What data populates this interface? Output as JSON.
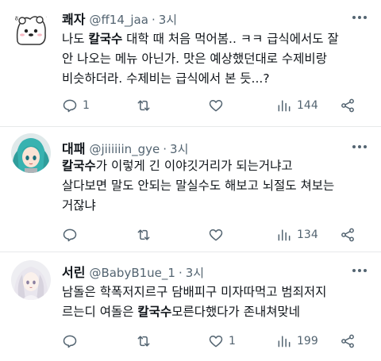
{
  "tweets": [
    {
      "name": "쾌자",
      "handle": "@ff14_jaa",
      "separator": "·",
      "time": "3시",
      "avatar": "chiikawa-bear-avatar",
      "lines": [
        [
          {
            "t": "나도 "
          },
          {
            "t": "칼국수",
            "b": true
          },
          {
            "t": " 대학 때 처음 먹어봄.. ㅋㅋ 급식에서도 잘"
          }
        ],
        [
          {
            "t": "안 나오는 메뉴 아닌가. 맛은 예상했던대로 수제비랑"
          }
        ],
        [
          {
            "t": "비슷하더라. 수제비는 급식에서 본 듯...?"
          }
        ]
      ],
      "replies": "1",
      "retweets": "",
      "likes": "",
      "views": "144"
    },
    {
      "name": "대패",
      "handle": "@jiiiiiin_gye",
      "separator": "·",
      "time": "3시",
      "avatar": "miku-avatar",
      "lines": [
        [
          {
            "t": "칼국수",
            "b": true
          },
          {
            "t": "가 이렇게 긴 이야깃거리가 되는거냐고"
          }
        ],
        [
          {
            "t": "살다보면 말도 안되는 말실수도 해보고 뇌절도 쳐보는"
          }
        ],
        [
          {
            "t": "거잖냐"
          }
        ]
      ],
      "replies": "",
      "retweets": "",
      "likes": "",
      "views": "134"
    },
    {
      "name": "서린",
      "handle": "@BabyB1ue_1",
      "separator": "·",
      "time": "3시",
      "avatar": "white-hair-girl-avatar",
      "lines": [
        [
          {
            "t": "남돌은 학폭저지르구 담배피구 미자따먹고 범죄저지"
          }
        ],
        [
          {
            "t": "르는디 여돌은 "
          },
          {
            "t": "칼국수",
            "b": true
          },
          {
            "t": "모른다했다가 존내쳐맞네"
          }
        ]
      ],
      "replies": "",
      "retweets": "",
      "likes": "1",
      "views": "199"
    }
  ],
  "colors": {
    "text": "#0f1419",
    "secondary": "#536471",
    "divider": "#e7e9ea"
  }
}
